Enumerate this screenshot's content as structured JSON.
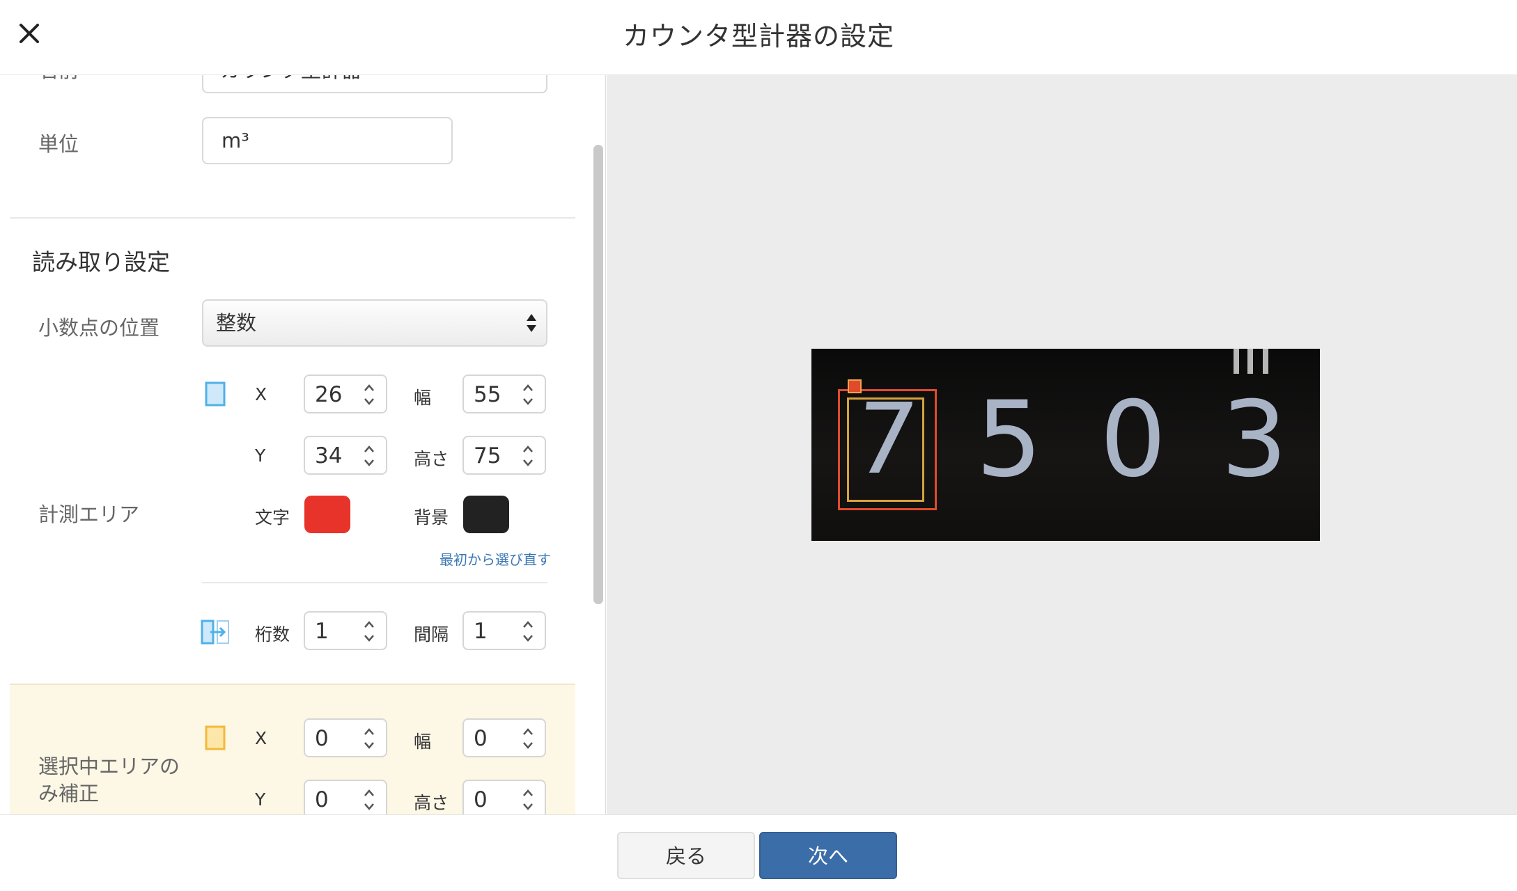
{
  "header": {
    "title": "カウンタ型計器の設定"
  },
  "basic": {
    "name_label": "名前",
    "name_value": "カウンタ型計器",
    "unit_label": "単位",
    "unit_value": "m³"
  },
  "reading": {
    "section_title": "読み取り設定",
    "decimal_label": "小数点の位置",
    "decimal_value": "整数",
    "area_label": "計測エリア",
    "x_label": "X",
    "x_value": "26",
    "width_label": "幅",
    "width_value": "55",
    "y_label": "Y",
    "y_value": "34",
    "height_label": "高さ",
    "height_value": "75",
    "char_label": "文字",
    "char_color": "#e8332a",
    "bg_label": "背景",
    "bg_color": "#222222",
    "reselect_link": "最初から選び直す",
    "digits_label": "桁数",
    "digits_value": "1",
    "interval_label": "間隔",
    "interval_value": "1"
  },
  "correction": {
    "label": "選択中エリアのみ補正",
    "x_label": "X",
    "x_value": "0",
    "width_label": "幅",
    "width_value": "0",
    "y_label": "Y",
    "y_value": "0",
    "height_label": "高さ",
    "height_value": "0"
  },
  "preview": {
    "digits": [
      "7",
      "5",
      "0",
      "3"
    ]
  },
  "footer": {
    "back_label": "戻る",
    "next_label": "次へ"
  }
}
